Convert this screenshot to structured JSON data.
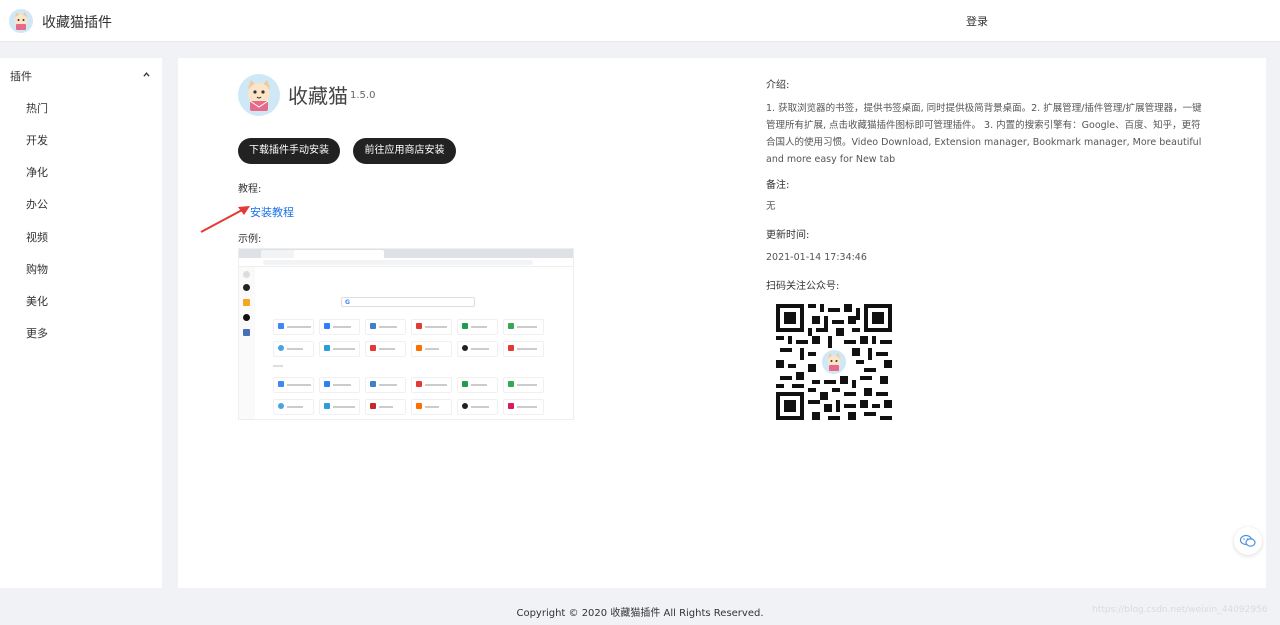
{
  "header": {
    "brand": "收藏猫插件",
    "login": "登录"
  },
  "sidebar": {
    "group_label": "插件",
    "items": [
      {
        "label": "热门"
      },
      {
        "label": "开发"
      },
      {
        "label": "净化"
      },
      {
        "label": "办公"
      },
      {
        "label": "视频"
      },
      {
        "label": "购物"
      },
      {
        "label": "美化"
      },
      {
        "label": "更多"
      }
    ]
  },
  "plugin": {
    "name": "收藏猫",
    "version": "1.5.0",
    "download_button": "下载插件手动安装",
    "store_button": "前往应用商店安装",
    "tutorial_label": "教程:",
    "tutorial_link": "安装教程",
    "example_label": "示例:"
  },
  "info": {
    "intro_title": "介绍:",
    "intro_text": "1. 获取浏览器的书签，提供书签桌面, 同时提供极简背景桌面。2. 扩展管理/插件管理/扩展管理器，一键管理所有扩展, 点击收藏猫插件图标即可管理插件。 3. 内置的搜索引擎有：Google、百度、知乎，更符合国人的使用习惯。Video Download, Extension manager, Bookmark manager, More beautiful and more easy for New tab",
    "note_title": "备注:",
    "note_value": "无",
    "updated_title": "更新时间:",
    "updated_value": "2021-01-14 17:34:46",
    "qr_title": "扫码关注公众号:"
  },
  "footer": {
    "copyright": "Copyright © 2020 收藏猫插件 All Rights Reserved.",
    "watermark": "https://blog.csdn.net/weixin_44092956"
  },
  "icons": {
    "logo": "cat-logo-icon",
    "chevron": "chevron-up-icon",
    "arrow": "red-arrow-annotation",
    "chat": "wechat-chat-icon"
  },
  "colors": {
    "link": "#1a73e8",
    "button_bg": "#222222",
    "arrow": "#e53935"
  }
}
